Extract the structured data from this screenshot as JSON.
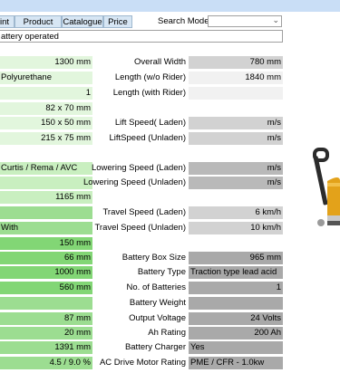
{
  "tabs": [
    {
      "label": "int"
    },
    {
      "label": "Product"
    },
    {
      "label": "Catalogue"
    },
    {
      "label": "Price"
    }
  ],
  "search": {
    "label": "Search Model",
    "value": ""
  },
  "description": "attery operated",
  "left_values": [
    "1300 mm",
    "Polyurethane",
    "1",
    "82 x 70 mm",
    "150 x 50 mm",
    "215 x 75 mm",
    "Curtis / Rema / AVC",
    "",
    "1165 mm",
    "",
    "With",
    "150 mm",
    "66 mm",
    "1000 mm",
    "560 mm",
    "",
    "87 mm",
    "20 mm",
    "1391 mm",
    "4.5 / 9.0 %"
  ],
  "specs": [
    {
      "label": "Overall Width",
      "value": "780 mm"
    },
    {
      "label": "Length (w/o Rider)",
      "value": "1840 mm"
    },
    {
      "label": "Length (with Rider)",
      "value": ""
    },
    {
      "label": "Lift Speed( Laden)",
      "value": "m/s"
    },
    {
      "label": "LiftSpeed (Unladen)",
      "value": "m/s"
    },
    {
      "label": "Lowering Speed (Laden)",
      "value": "m/s"
    },
    {
      "label": "Lowering Speed (Unladen)",
      "value": "m/s"
    },
    {
      "label": "Travel Speed (Laden)",
      "value": "6 km/h"
    },
    {
      "label": "Travel Speed (Unladen)",
      "value": "10 km/h"
    },
    {
      "label": "Battery Box Size",
      "value": "965 mm"
    },
    {
      "label": "Battery Type",
      "value": "Traction type lead acid"
    },
    {
      "label": "No. of Batteries",
      "value": "1"
    },
    {
      "label": "Battery Weight",
      "value": ""
    },
    {
      "label": "Output Voltage",
      "value": "24 Volts"
    },
    {
      "label": "Ah Rating",
      "value": "200 Ah"
    },
    {
      "label": "Battery Charger",
      "value": "Yes"
    },
    {
      "label": "AC Drive Motor Rating",
      "value": "PME / CFR - 1.0kw"
    }
  ],
  "icons": {
    "search_dropdown": "chevron-down-icon",
    "product_image": "pallet-truck-illustration"
  }
}
